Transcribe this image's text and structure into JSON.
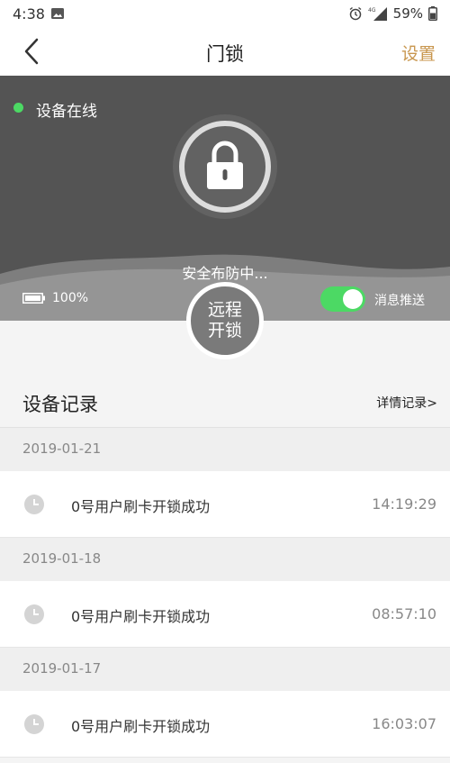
{
  "status_bar": {
    "time": "4:38",
    "battery": "59%",
    "network": "4G"
  },
  "nav": {
    "title": "门锁",
    "settings_label": "设置"
  },
  "device": {
    "online_label": "设备在线",
    "arm_status": "安全布防中...",
    "battery_label": "100%",
    "battery_level": 1.0,
    "push_label": "消息推送",
    "push_enabled": true,
    "remote_unlock_line1": "远程",
    "remote_unlock_line2": "开锁"
  },
  "records": {
    "title": "设备记录",
    "details_link": "详情记录>",
    "groups": [
      {
        "date": "2019-01-21",
        "items": [
          {
            "message": "0号用户刷卡开锁成功",
            "time": "14:19:29"
          }
        ]
      },
      {
        "date": "2019-01-18",
        "items": [
          {
            "message": "0号用户刷卡开锁成功",
            "time": "08:57:10"
          }
        ]
      },
      {
        "date": "2019-01-17",
        "items": [
          {
            "message": "0号用户刷卡开锁成功",
            "time": "16:03:07"
          }
        ]
      }
    ]
  },
  "colors": {
    "accent": "#c8964e",
    "online": "#4cd964",
    "hero_bg": "#545454",
    "toggle_on": "#4cd964"
  }
}
